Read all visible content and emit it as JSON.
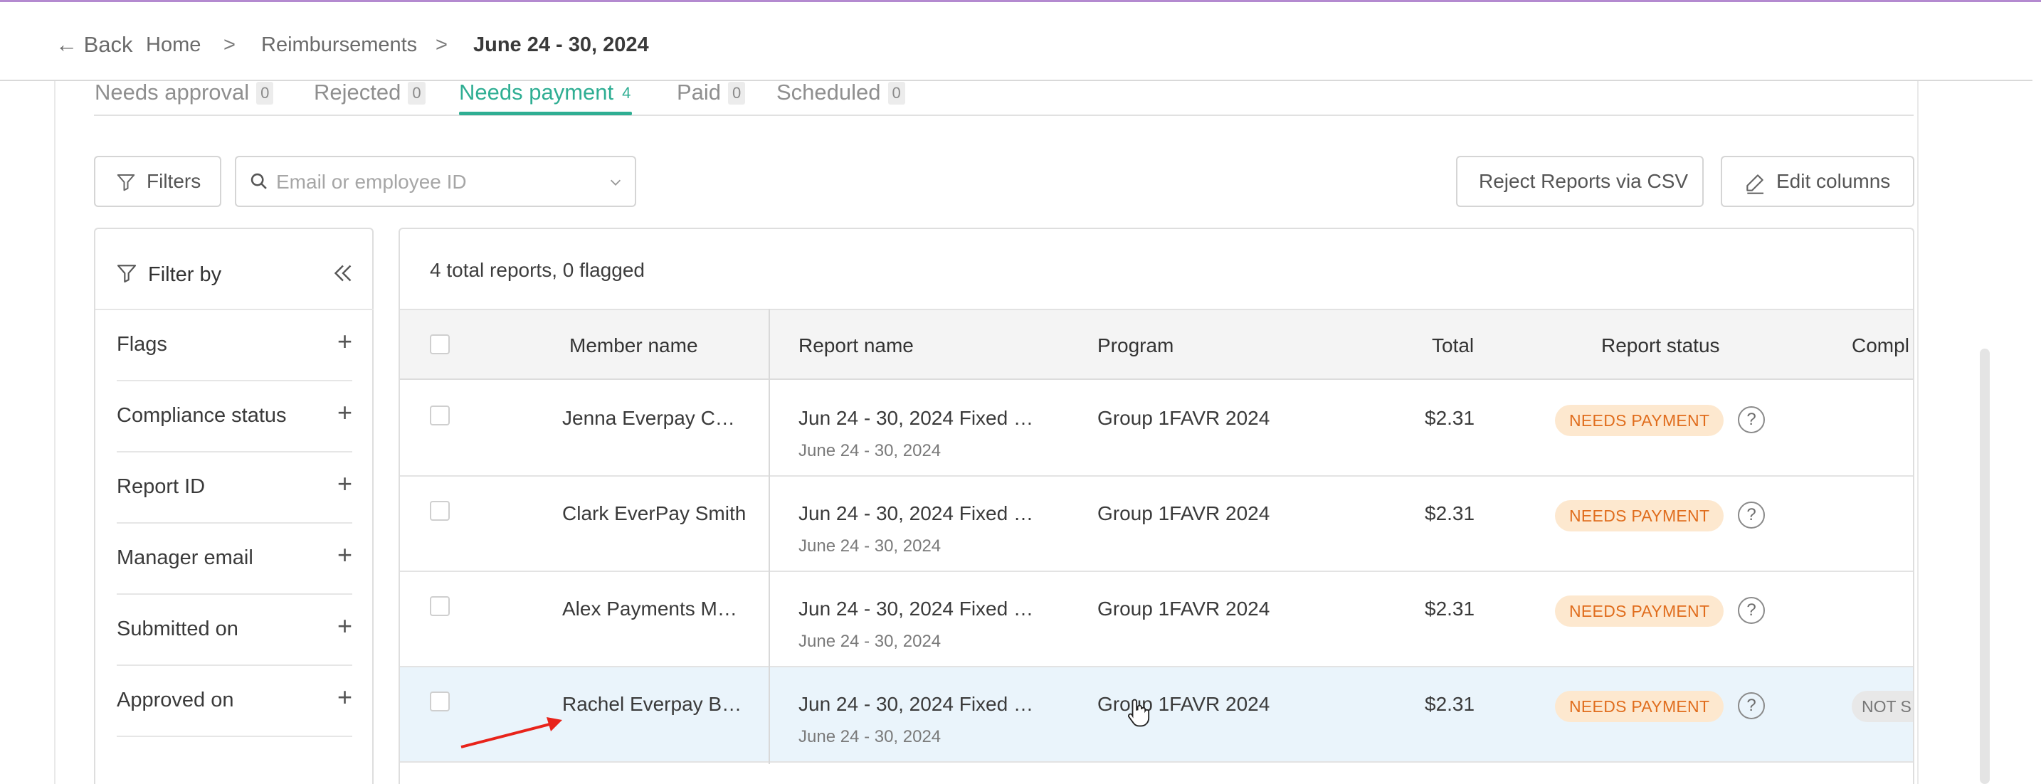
{
  "header": {
    "back_label": "← Back",
    "breadcrumb": {
      "home": "Home",
      "separator": ">",
      "section": "Reimbursements",
      "current": "June 24 - 30, 2024"
    }
  },
  "tabs": [
    {
      "label": "Needs approval",
      "count": "0"
    },
    {
      "label": "Rejected",
      "count": "0"
    },
    {
      "label": "Needs payment",
      "count": "4"
    },
    {
      "label": "Paid",
      "count": "0"
    },
    {
      "label": "Scheduled",
      "count": "0"
    }
  ],
  "toolbar": {
    "filters_label": "Filters",
    "search_placeholder": "Email or employee ID",
    "reject_csv_label": "Reject Reports via CSV",
    "edit_columns_label": "Edit columns"
  },
  "filter_panel": {
    "title": "Filter by",
    "items": [
      "Flags",
      "Compliance status",
      "Report ID",
      "Manager email",
      "Submitted on",
      "Approved on"
    ]
  },
  "table": {
    "summary": "4 total reports, 0 flagged",
    "columns": {
      "member_name": "Member name",
      "report_name": "Report name",
      "program": "Program",
      "total": "Total",
      "report_status": "Report status",
      "compliance": "Compl"
    },
    "rows": [
      {
        "member": "Jenna Everpay C…",
        "report": "Jun 24 - 30, 2024 Fixed …",
        "period": "June 24 - 30, 2024",
        "program": "Group 1FAVR 2024",
        "total": "$2.31",
        "status": "NEEDS PAYMENT"
      },
      {
        "member": "Clark EverPay Smith",
        "report": "Jun 24 - 30, 2024 Fixed …",
        "period": "June 24 - 30, 2024",
        "program": "Group 1FAVR 2024",
        "total": "$2.31",
        "status": "NEEDS PAYMENT"
      },
      {
        "member": "Alex Payments M…",
        "report": "Jun 24 - 30, 2024 Fixed …",
        "period": "June 24 - 30, 2024",
        "program": "Group 1FAVR 2024",
        "total": "$2.31",
        "status": "NEEDS PAYMENT"
      },
      {
        "member": "Rachel Everpay B…",
        "report": "Jun 24 - 30, 2024 Fixed …",
        "period": "June 24 - 30, 2024",
        "program": "Group 1FAVR 2024",
        "total": "$2.31",
        "status": "NEEDS PAYMENT",
        "compliance": "NOT S"
      }
    ]
  },
  "icons": [
    "filter-icon",
    "search-icon",
    "chevron-down-icon",
    "pencil-icon",
    "collapse-icon",
    "plus-icon",
    "help-icon"
  ],
  "colors": {
    "accent": "#2fae93",
    "status_bg": "#fde8cf",
    "status_text": "#e06d1d",
    "highlight_row": "#eaf4fb",
    "annotation_arrow": "#e8231a"
  }
}
